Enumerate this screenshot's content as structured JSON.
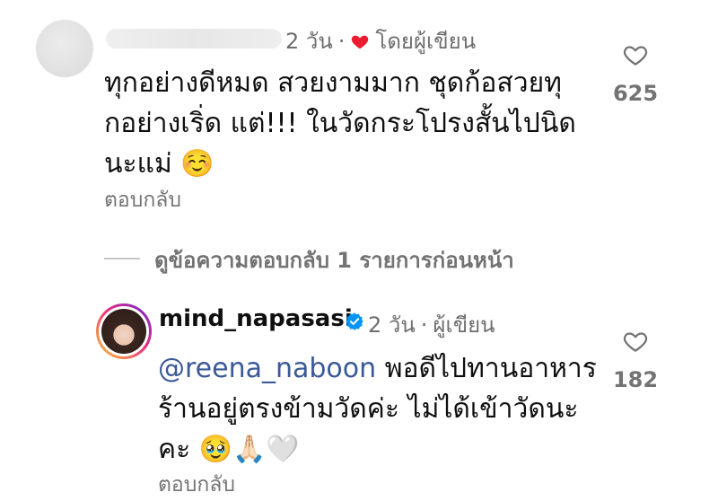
{
  "comment1": {
    "time": "2 วัน",
    "separator": "·",
    "liked_by_author_label": "โดยผู้เขียน",
    "text": "ทุกอย่างดีหมด สวยงามมาก ชุดก้อสวยทุกอย่างเริ่ด แต่!!! ในวัดกระโปรงสั้นไปนิดนะแม่ ☺️",
    "reply_label": "ตอบกลับ",
    "like_count": "625"
  },
  "view_previous_replies": "ดูข้อความตอบกลับ 1 รายการก่อนหน้า",
  "comment2": {
    "username": "mind_napasasi",
    "time": "2 วัน",
    "separator": "·",
    "author_label": "ผู้เขียน",
    "mention": "@reena_naboon",
    "text": " พอดีไปทานอาหารร้านอยู่ตรงข้ามวัดค่ะ ไม่ได้เข้าวัดนะคะ 🥹🙏🏻🤍",
    "reply_label": "ตอบกลับ",
    "like_count": "182"
  },
  "colors": {
    "heart_red": "#ed1b2f",
    "verified_blue": "#0095f6",
    "mention_blue": "#3b5998",
    "muted_gray": "#737373"
  },
  "icons": {
    "like": "heart-outline-icon",
    "liked_by_author": "heart-filled-icon",
    "verified": "verified-badge-icon"
  }
}
